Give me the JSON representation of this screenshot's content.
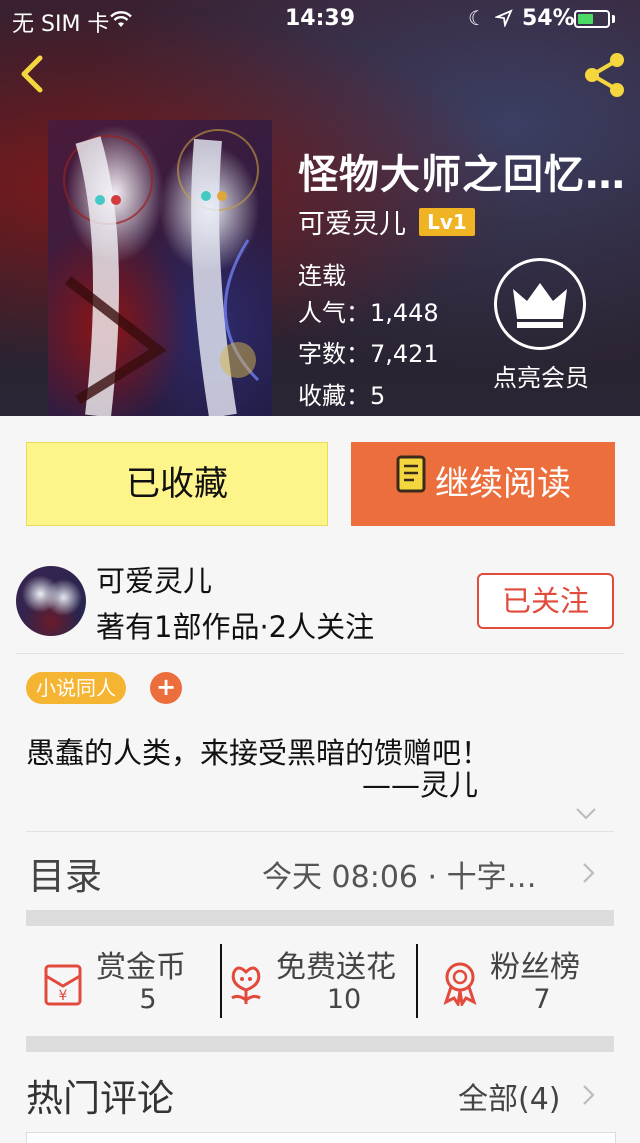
{
  "status_bar": {
    "carrier": "无 SIM 卡",
    "time": "14:39",
    "battery_percent": "54%",
    "battery_level": 0.54,
    "battery_color": "#4cd964"
  },
  "nav": {
    "back_icon": "chevron-left-icon",
    "share_icon": "share-icon",
    "icon_color": "#f4d63e"
  },
  "book": {
    "title": "怪物大师之回忆…",
    "author": "可爱灵儿",
    "level": "Lv1",
    "status": "连载",
    "popularity": "人气：1,448",
    "word_count": "字数：7,421",
    "favorites": "收藏：5"
  },
  "vip": {
    "label": "点亮会员",
    "icon": "crown-icon"
  },
  "actions": {
    "collected_label": "已收藏",
    "read_label": "继续阅读",
    "read_icon": "book-icon",
    "collected_bg": "#fdf48a",
    "read_bg": "#ec6e3d"
  },
  "author_block": {
    "name": "可爱灵儿",
    "stats": "著有1部作品·2人关注",
    "follow_label": "已关注",
    "follow_color": "#e24a3c"
  },
  "tags": {
    "items": [
      "小说同人"
    ],
    "add_label": "+"
  },
  "description": {
    "line1": "愚蠢的人类，来接受黑暗的馈赠吧！",
    "line2": "——灵儿"
  },
  "toc": {
    "title": "目录",
    "latest": "今天 08:06 · 十字…"
  },
  "stats": {
    "reward": {
      "label": "赏金币",
      "value": "5",
      "icon": "red-envelope-icon"
    },
    "flower": {
      "label": "免费送花",
      "value": "10",
      "icon": "flower-icon"
    },
    "fans": {
      "label": "粉丝榜",
      "value": "7",
      "icon": "medal-icon"
    }
  },
  "comments": {
    "title": "热门评论",
    "all_label": "全部(4)"
  }
}
